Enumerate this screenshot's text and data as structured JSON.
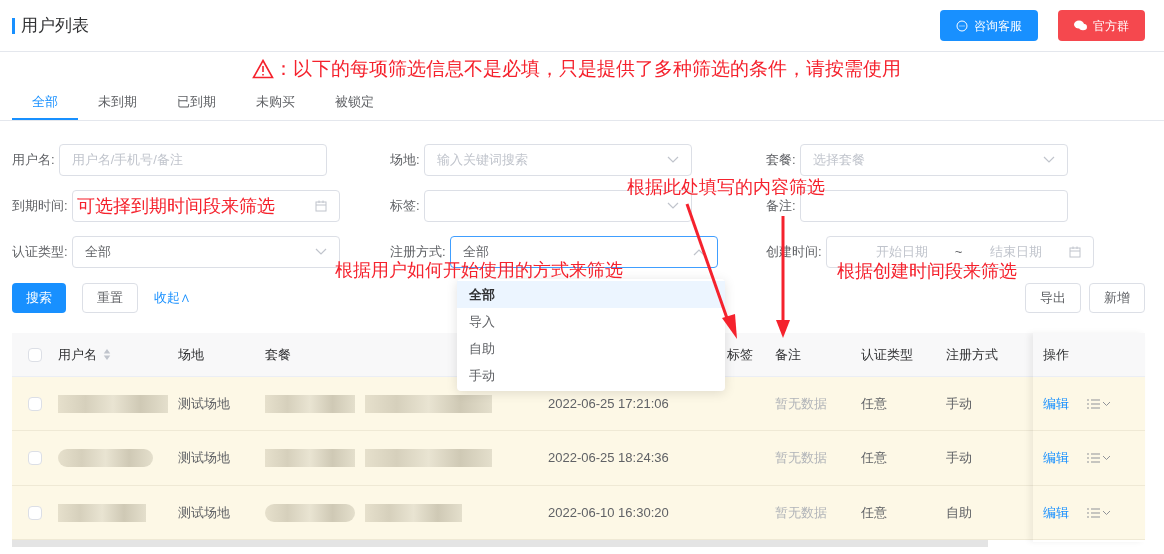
{
  "header": {
    "title": "用户列表",
    "buttons": [
      {
        "label": "咨询客服",
        "kind": "primary"
      },
      {
        "label": "官方群",
        "kind": "danger"
      }
    ]
  },
  "notice": {
    "text": "：以下的每项筛选信息不是必填，只是提供了多种筛选的条件，请按需使用"
  },
  "tabs": [
    {
      "label": "全部",
      "selected": true
    },
    {
      "label": "未到期",
      "selected": false
    },
    {
      "label": "已到期",
      "selected": false
    },
    {
      "label": "未购买",
      "selected": false
    },
    {
      "label": "被锁定",
      "selected": false
    }
  ],
  "filters": [
    {
      "label": "用户名:",
      "kind": "input",
      "placeholder": "用户名/手机号/备注",
      "focused": false
    },
    {
      "label": "场地:",
      "kind": "select",
      "placeholder": "输入关键词搜索",
      "focused": false
    },
    {
      "label": "套餐:",
      "kind": "select",
      "placeholder": "选择套餐",
      "focused": false
    },
    {
      "label": "到期时间:",
      "kind": "date",
      "focused": false
    },
    {
      "label": "标签:",
      "kind": "select",
      "focused": false
    },
    {
      "label": "备注:",
      "kind": "input",
      "focused": false
    },
    {
      "label": "认证类型:",
      "kind": "select",
      "value": "全部",
      "focused": false
    },
    {
      "label": "注册方式:",
      "kind": "select",
      "value": "全部",
      "focused": true
    },
    {
      "label": "创建时间:",
      "kind": "daterange",
      "start_placeholder": "开始日期",
      "separator": "~",
      "end_placeholder": "结束日期",
      "focused": false
    }
  ],
  "actions": {
    "search": "搜索",
    "reset": "重置",
    "collapse": "收起∧",
    "export": "导出",
    "add": "新增"
  },
  "dropdown": {
    "options": [
      {
        "label": "全部",
        "selected": true
      },
      {
        "label": "导入",
        "selected": false
      },
      {
        "label": "自助",
        "selected": false
      },
      {
        "label": "手动",
        "selected": false
      }
    ]
  },
  "table": {
    "all_checked": false,
    "columns": [
      {
        "label": "用户名",
        "sortable": true
      },
      {
        "label": "场地",
        "sortable": false
      },
      {
        "label": "套餐",
        "sortable": false
      },
      {
        "label": "标签",
        "sortable": false
      },
      {
        "label": "备注",
        "sortable": false
      },
      {
        "label": "认证类型",
        "sortable": false
      },
      {
        "label": "注册方式",
        "sortable": false
      },
      {
        "label": "操作",
        "sortable": false
      }
    ],
    "rows": [
      {
        "checked": false,
        "venue": "测试场地",
        "created": "2022-06-25 17:21:06",
        "remark": "暂无数据",
        "auth_type": "任意",
        "reg_method": "手动",
        "action": "编辑"
      },
      {
        "checked": false,
        "venue": "测试场地",
        "created": "2022-06-25 18:24:36",
        "remark": "暂无数据",
        "auth_type": "任意",
        "reg_method": "手动",
        "action": "编辑"
      },
      {
        "checked": false,
        "venue": "测试场地",
        "created": "2022-06-10 16:30:20",
        "remark": "暂无数据",
        "auth_type": "任意",
        "reg_method": "自助",
        "action": "编辑"
      }
    ]
  },
  "annotations": [
    {
      "text": "可选择到期时间段来筛选"
    },
    {
      "text": "根据此处填写的内容筛选"
    },
    {
      "text": "根据用户如何开始使用的方式来筛选"
    },
    {
      "text": "根据创建时间段来筛选"
    }
  ]
}
